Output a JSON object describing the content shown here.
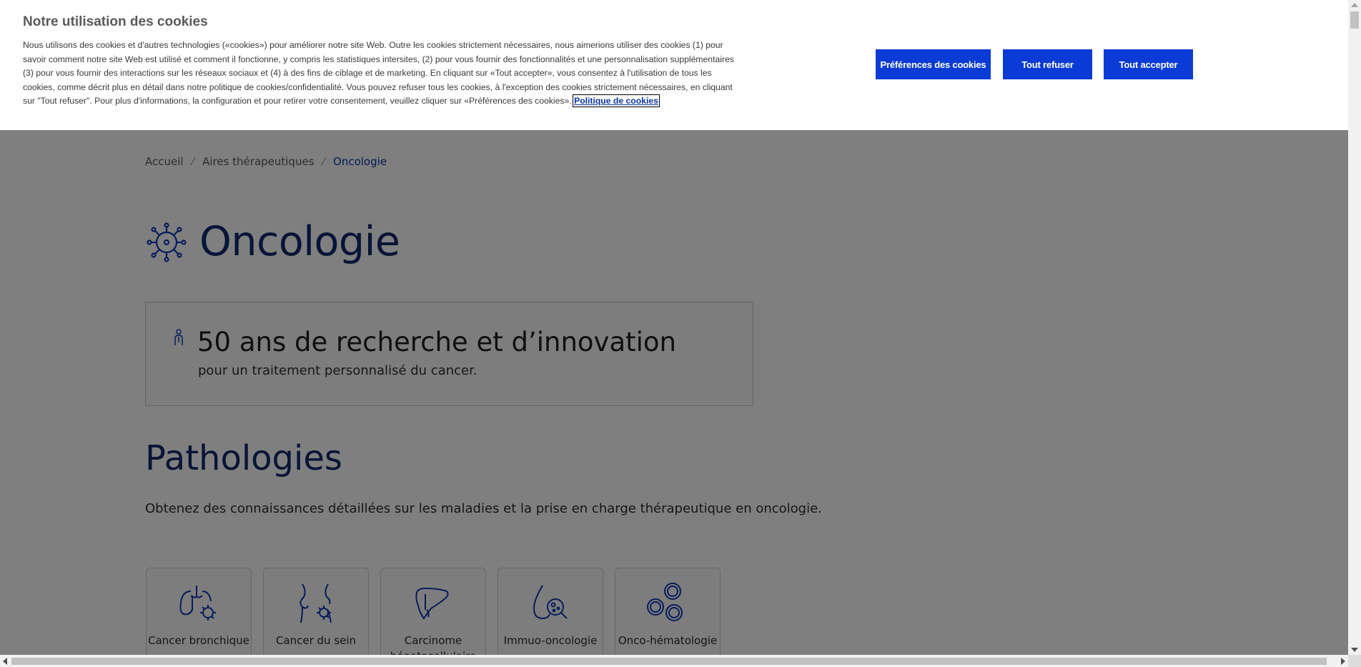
{
  "breadcrumb": {
    "home": "Accueil",
    "area": "Aires thérapeutiques",
    "current": "Oncologie"
  },
  "page": {
    "title": "Oncologie",
    "title_icon": "cancer-cell-icon"
  },
  "promo": {
    "icon": "researcher-icon",
    "title": "50 ans de recherche et d’innovation",
    "subtitle": "pour un traitement personnalisé du cancer."
  },
  "pathologies": {
    "title": "Pathologies",
    "description": "Obtenez des connaissances détaillées sur les maladies et la prise en charge thérapeutique en oncologie.",
    "cards": [
      {
        "label": "Cancer bronchique",
        "icon": "lungs-icon"
      },
      {
        "label": "Cancer du sein",
        "icon": "breast-icon"
      },
      {
        "label": "Carcinome hépatocellulaire",
        "icon": "liver-icon"
      },
      {
        "label": "Immuo-oncologie",
        "icon": "drop-magnifier-icon"
      },
      {
        "label": "Onco-hématologie",
        "icon": "blood-cells-icon"
      }
    ]
  },
  "cookie_banner": {
    "title": "Notre utilisation des cookies",
    "text": "Nous utilisons des cookies et d'autres technologies («cookies») pour améliorer notre site Web. Outre les cookies strictement nécessaires, nous aimerions utiliser des cookies (1) pour savoir comment notre site Web est utilisé et comment il fonctionne, y compris les statistiques intersites, (2) pour vous fournir des fonctionnalités et une personnalisation supplémentaires (3) pour vous fournir des interactions sur les réseaux sociaux et (4) à des fins de ciblage et de marketing. En cliquant sur «Tout accepter», vous consentez à l'utilisation de tous les cookies, comme décrit plus en détail dans notre politique de cookies/confidentialité. Vous pouvez refuser tous les cookies, à l'exception des cookies strictement nécessaires, en cliquant sur \"Tout refuser\". Pour plus d'informations, la configuration et pour retirer votre consentement, veuillez cliquer sur «Préférences des cookies».",
    "policy_link": "Politique de cookies",
    "prefs_button": "Préférences des cookies",
    "refuse_button": "Tout refuser",
    "accept_button": "Tout accepter",
    "button_color": "#0b3bd6"
  },
  "colors": {
    "heading_blue": "#0b2a6e",
    "link_blue": "#0a36a8",
    "overlay": "rgba(0,0,0,0.5)"
  }
}
